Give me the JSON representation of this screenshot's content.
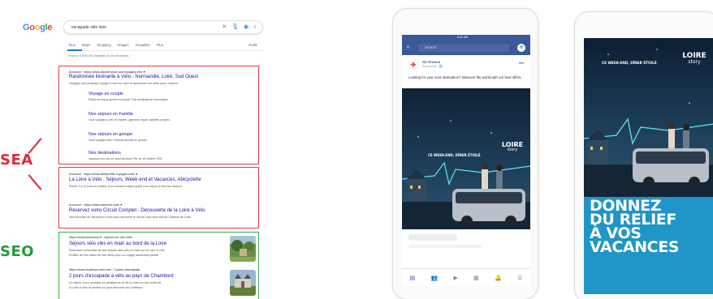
{
  "serp": {
    "logo": [
      "G",
      "o",
      "o",
      "g",
      "l",
      "e"
    ],
    "query": "escapade vélo loire",
    "icons": {
      "clear": "close-icon",
      "mic": "microphone-icon",
      "camera": "camera-icon",
      "search": "search-icon"
    },
    "tabs": [
      "Tous",
      "Maps",
      "Shopping",
      "Images",
      "Actualités",
      "Plus"
    ],
    "tools": "Outils",
    "result_count": "Environ 5 600 000 résultats (0,45 secondes)",
    "ad1": {
      "url": "Annonce · https://www.aboutfrance.com/voyages-velo ▾",
      "title": "Randonnée itinérante à Vélo - Normandie, Loire, Sud Ouest",
      "desc": "Voyagez vélo proposer voyage à vélo en Loire et randonnée sur cette zone, motivez...",
      "sitelinks": [
        {
          "title": "Voyage en couple",
          "desc": "Partez en séjour sportif en couple ! Nos destinations romantiques"
        },
        {
          "title": "Nos séjours en Famille",
          "desc": "Vous voyagez à vélo en famille Logement, repas, activités compris"
        },
        {
          "title": "Nos séjours en groupe",
          "desc": "Vous voyagez seul ? Séjours sportifs en groupe"
        },
        {
          "title": "Nos destinations",
          "desc": "Vacances en vélo en sport aventure Prix du 18 octobre 2021"
        }
      ]
    },
    "ad2": {
      "url": "Annonce · https://www.alterprofile.voyages.com/ ▾",
      "title": "La Loire à Vélo : Séjours, Week-end et Vacances, Abicyclette",
      "desc": "Partez 3 à 10 jours et profitez d'un moment unique grâce à un séjour à vélo sur mesure",
      "url2": "Annonce · https://www.loirevelo.com/ ▾",
      "title2": "Réservez votre Circuit Complet - Découverte de la Loire à Vélo",
      "desc2": "Nos formules de Vacances à Vélo pour découvrir le Val de Loire avec Beuvè Château de Loire"
    },
    "seo": {
      "url1": "https://www.loireavelo.fr › séjours-en-velo-loire",
      "title1": "Séjours vélo clés en main au bord de la Loire",
      "desc1": "Retrouvez l'ensemble de nos séjours vélo clés en main sur la Loire à Vélo,",
      "desc1b": "Profitez de nos dates de nos offres pour un voyage facilement parfait",
      "url2": "https://www.chateaux-velo.com › 2-jours-descapade",
      "title2": "2 jours d'escapade à vélo au pays de Chambord",
      "desc2": "Un séjour d'une semaine en pédalant au fil de la Loire sur les routes de",
      "desc2b": "la Loire à Vélo et profitez en pour découvrir les Châteaux"
    },
    "label_sea": "SEA",
    "label_seo": "SEO"
  },
  "facebook": {
    "status_time": "9:41 AM",
    "search_placeholder": "Search",
    "advertiser": "Air France",
    "sponsored": "Sponsored · 🌐",
    "post_text": "Looking for your next destination? Discover the world with our best offers.",
    "ad_tagline": "CE WEEK-END, DÎNER ÉTOILÉ",
    "brand_l1": "LOIRE",
    "brand_l2": "story",
    "nav_icons": [
      "news-feed-icon",
      "groups-icon",
      "watch-icon",
      "marketplace-icon",
      "notifications-icon",
      "menu-icon"
    ]
  },
  "story": {
    "ad_tagline": "CE WEEK-END, DÎNER ÉTOILÉ",
    "brand_l1": "LOIRE",
    "brand_l2": "story",
    "headline": [
      "DONNEZ",
      "DU RELIEF",
      "À VOS",
      "VACANCES"
    ]
  },
  "colors": {
    "sea": "#e0283c",
    "seo": "#1d9e3a",
    "fb": "#3b5998",
    "story_bg": "#1f95c8",
    "link": "#1a0dab"
  }
}
